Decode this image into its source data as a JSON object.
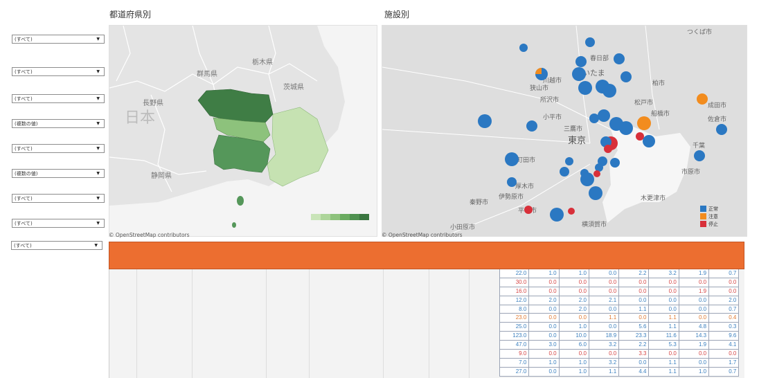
{
  "titles": {
    "prefecture": "都道府県別",
    "facility": "施設別"
  },
  "filters": [
    {
      "value": "(すべて)"
    },
    {
      "value": "(すべて)"
    },
    {
      "value": "(すべて)"
    },
    {
      "value": "(複数の値)"
    },
    {
      "value": "(すべて)"
    },
    {
      "value": "(複数の値)"
    },
    {
      "value": "(すべて)"
    },
    {
      "value": "(すべて)"
    },
    {
      "value": "(すべて)"
    }
  ],
  "map_left": {
    "attribution": "© OpenStreetMap contributors",
    "labels": [
      "群馬県",
      "栃木県",
      "茨城県",
      "長野県",
      "日本",
      "静岡県"
    ],
    "legend_colors": [
      "#c9e4b8",
      "#add59a",
      "#8dc27c",
      "#6aab60",
      "#4f9150",
      "#3a7640"
    ]
  },
  "map_right": {
    "attribution": "© OpenStreetMap contributors",
    "labels": [
      "つくば市",
      "川越市",
      "さいたま",
      "春日部",
      "柏市",
      "所沢市",
      "狭山市",
      "松戸市",
      "船橋市",
      "成田市",
      "佐倉市",
      "小平市",
      "三鷹市",
      "東京",
      "千葉",
      "市原市",
      "町田市",
      "厚木市",
      "秦野市",
      "伊勢原市",
      "平塚市",
      "小田原市",
      "横須賀市",
      "木更津市"
    ],
    "legend": [
      {
        "label": "正常",
        "color": "#2b78c2"
      },
      {
        "label": "注意",
        "color": "#f28c1e"
      },
      {
        "label": "停止",
        "color": "#d8303a"
      }
    ]
  },
  "table": {
    "rows": [
      {
        "status": "ok",
        "values": [
          "22.0",
          "1.0",
          "1.0",
          "0.0",
          "2.2",
          "3.2",
          "1.9",
          "0.7"
        ]
      },
      {
        "status": "stop",
        "values": [
          "30.0",
          "0.0",
          "0.0",
          "0.0",
          "0.0",
          "0.0",
          "0.0",
          "0.0"
        ]
      },
      {
        "status": "stop",
        "values": [
          "16.0",
          "0.0",
          "0.0",
          "0.0",
          "0.0",
          "0.0",
          "1.9",
          "0.0"
        ]
      },
      {
        "status": "ok",
        "values": [
          "12.0",
          "2.0",
          "2.0",
          "2.1",
          "0.0",
          "0.0",
          "0.0",
          "2.0"
        ]
      },
      {
        "status": "ok",
        "values": [
          "8.0",
          "0.0",
          "2.0",
          "0.0",
          "1.1",
          "0.0",
          "0.0",
          "0.7"
        ]
      },
      {
        "status": "warn",
        "values": [
          "23.0",
          "0.0",
          "0.0",
          "1.1",
          "0.0",
          "1.1",
          "0.0",
          "0.4"
        ]
      },
      {
        "status": "ok",
        "values": [
          "25.0",
          "0.0",
          "1.0",
          "0.0",
          "5.6",
          "1.1",
          "4.8",
          "0.3"
        ]
      },
      {
        "status": "ok",
        "values": [
          "123.0",
          "0.0",
          "10.0",
          "18.9",
          "23.3",
          "11.6",
          "14.3",
          "9.6"
        ]
      },
      {
        "status": "ok",
        "values": [
          "47.0",
          "3.0",
          "6.0",
          "3.2",
          "2.2",
          "5.3",
          "1.9",
          "4.1"
        ]
      },
      {
        "status": "stop",
        "values": [
          "9.0",
          "0.0",
          "0.0",
          "0.0",
          "3.3",
          "0.0",
          "0.0",
          "0.0"
        ]
      },
      {
        "status": "ok",
        "values": [
          "7.0",
          "1.0",
          "1.0",
          "3.2",
          "0.0",
          "1.1",
          "0.0",
          "1.7"
        ]
      },
      {
        "status": "ok",
        "values": [
          "27.0",
          "0.0",
          "1.0",
          "1.1",
          "4.4",
          "1.1",
          "1.0",
          "0.7"
        ]
      }
    ]
  }
}
